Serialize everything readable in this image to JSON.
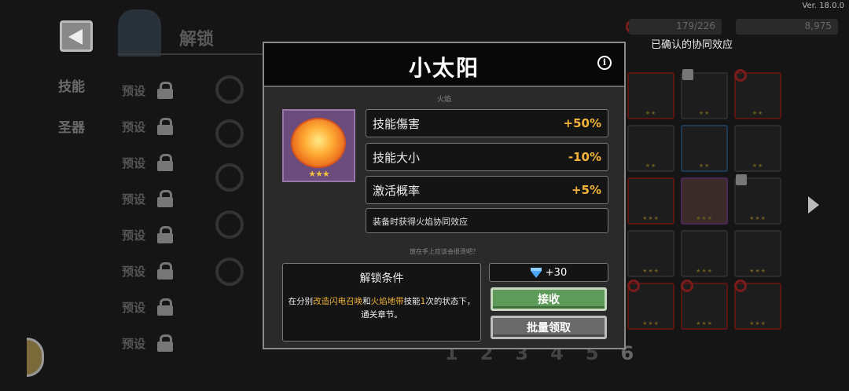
{
  "app": {
    "version": "Ver. 18.0.0",
    "screen_title": "解锁",
    "tabs": [
      {
        "label": "技能"
      },
      {
        "label": "圣器"
      }
    ],
    "preset_label": "预设",
    "page_numbers": [
      "1",
      "2",
      "3",
      "4",
      "5",
      "6"
    ],
    "counter_primary": "179/226",
    "counter_gems": "8,975",
    "synergy_header": "已确认的协同效应"
  },
  "modal": {
    "title": "小太阳",
    "element": "火焰",
    "stars": "★★★",
    "stats": [
      {
        "name": "技能傷害",
        "value": "+50%"
      },
      {
        "name": "技能大小",
        "value": "-10%"
      },
      {
        "name": "激活概率",
        "value": "+5%"
      }
    ],
    "synergy_note": "装备时获得火焰协同效应",
    "hint": "放在手上应该会很烫吧？",
    "unlock": {
      "title": "解锁条件",
      "prefix": "在分别",
      "skill_a": "改造闪电召唤",
      "conj": "和",
      "skill_b": "火焰地带",
      "middle": "技能",
      "times": "1",
      "suffix": "次的状态下，通关章节。"
    },
    "reward": "+30",
    "receive_label": "接收",
    "batch_label": "批量领取"
  },
  "colors": {
    "accent_orange": "#f2b43a",
    "receive_green": "#5e9a5a",
    "gem_blue": "#4aa8ff"
  }
}
